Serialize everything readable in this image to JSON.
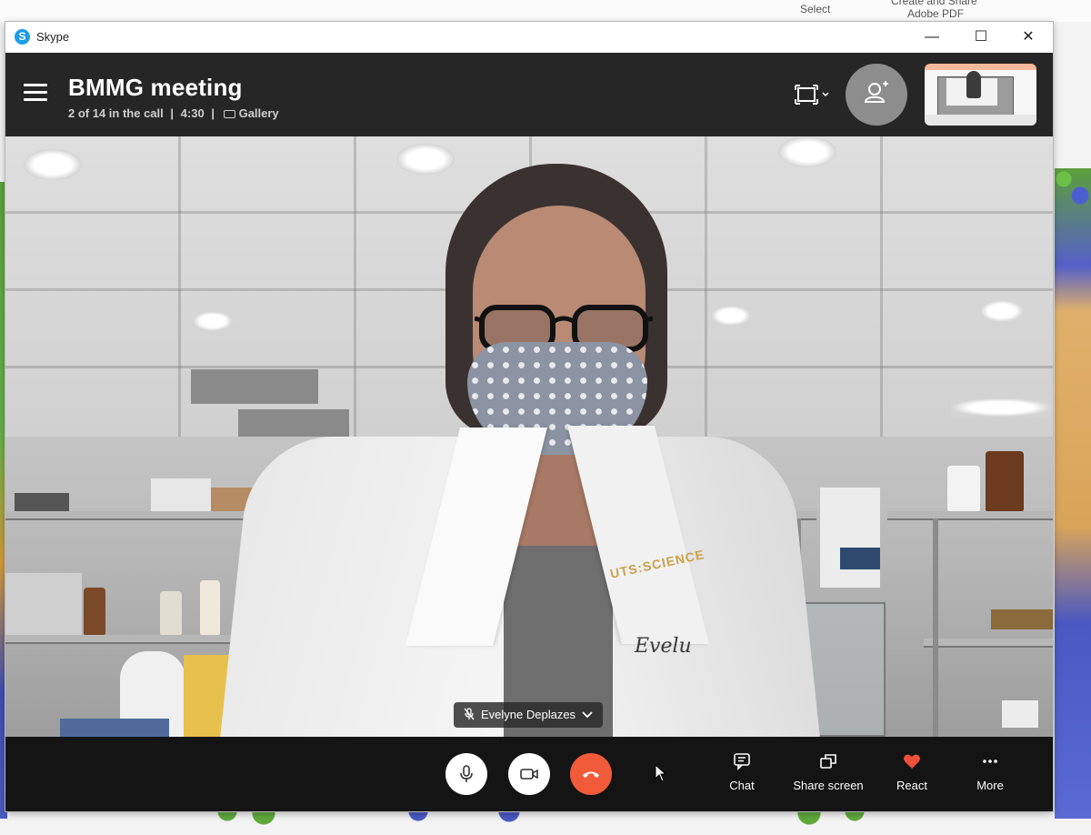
{
  "background_app": {
    "ribbon_items": [
      "Select",
      "Create and Share",
      "Adobe PDF"
    ]
  },
  "window": {
    "app_title": "Skype",
    "minimize": "—",
    "maximize": "☐",
    "close": "✕"
  },
  "call": {
    "title": "BMMG meeting",
    "participants": "2 of 14 in the call",
    "duration": "4:30",
    "view_mode": "Gallery",
    "separator": "|"
  },
  "video": {
    "speaker_name": "Evelyne Deplazes",
    "coat_logo": "UTS:SCIENCE",
    "coat_name": "Evelu"
  },
  "toolbar": {
    "chat_label": "Chat",
    "share_label": "Share screen",
    "react_label": "React",
    "more_label": "More"
  },
  "colors": {
    "header_bg": "#262626",
    "control_bg": "#141414",
    "end_call": "#f25b3a",
    "react_heart": "#f0503a",
    "skype_blue": "#1b9ee5"
  },
  "icons": {
    "menu": "hamburger-icon",
    "layout": "expand-layout-icon",
    "add_people": "add-person-icon",
    "mic": "microphone-icon",
    "video": "video-camera-icon",
    "hangup": "phone-hangup-icon",
    "chat": "chat-icon",
    "share": "share-screen-icon",
    "react": "heart-icon",
    "more": "ellipsis-icon"
  }
}
